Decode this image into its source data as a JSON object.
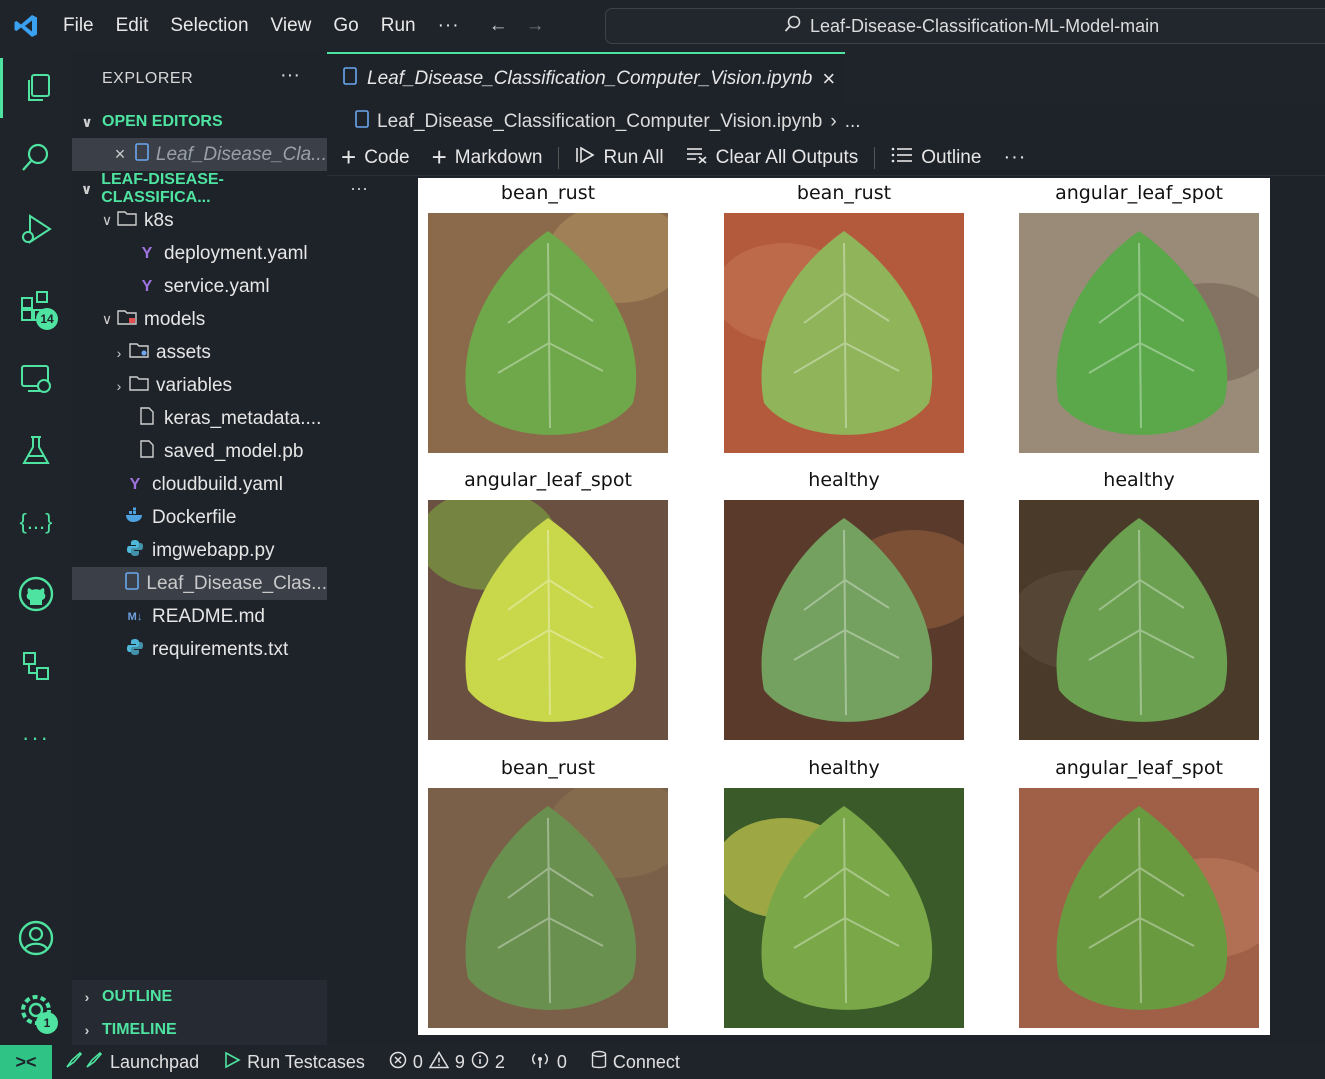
{
  "titlebar": {
    "menu": [
      "File",
      "Edit",
      "Selection",
      "View",
      "Go",
      "Run"
    ],
    "more": "···",
    "search": "Leaf-Disease-Classification-ML-Model-main"
  },
  "activity": {
    "extensions_badge": "14",
    "settings_badge": "1"
  },
  "sidebar": {
    "title": "EXPLORER",
    "dots": "···",
    "open_editors": "OPEN EDITORS",
    "open_editor_file": "Leaf_Disease_Cla...",
    "project": "LEAF-DISEASE-CLASSIFICA...",
    "items": [
      {
        "label": "k8s"
      },
      {
        "label": "deployment.yaml"
      },
      {
        "label": "service.yaml"
      },
      {
        "label": "models"
      },
      {
        "label": "assets"
      },
      {
        "label": "variables"
      },
      {
        "label": "keras_metadata...."
      },
      {
        "label": "saved_model.pb"
      },
      {
        "label": "cloudbuild.yaml"
      },
      {
        "label": "Dockerfile"
      },
      {
        "label": "imgwebapp.py"
      },
      {
        "label": "Leaf_Disease_Clas..."
      },
      {
        "label": "README.md"
      },
      {
        "label": "requirements.txt"
      }
    ],
    "outline": "OUTLINE",
    "timeline": "TIMELINE"
  },
  "editor": {
    "tab_label": "Leaf_Disease_Classification_Computer_Vision.ipynb",
    "breadcrumb_file": "Leaf_Disease_Classification_Computer_Vision.ipynb",
    "breadcrumb_more": "...",
    "toolbar": {
      "code": "Code",
      "markdown": "Markdown",
      "run_all": "Run All",
      "clear": "Clear All Outputs",
      "outline": "Outline",
      "more": "···"
    },
    "cell_dots": "···"
  },
  "output": {
    "images": [
      {
        "label": "bean_rust",
        "palette": [
          "#8a6a4a",
          "#6fa84a",
          "#a88a5c"
        ]
      },
      {
        "label": "bean_rust",
        "palette": [
          "#b45a3c",
          "#8fb45a",
          "#c07050"
        ]
      },
      {
        "label": "angular_leaf_spot",
        "palette": [
          "#9a8a78",
          "#5aa84a",
          "#7a6a58"
        ]
      },
      {
        "label": "angular_leaf_spot",
        "palette": [
          "#6a5040",
          "#c8d84a",
          "#7a9a40"
        ]
      },
      {
        "label": "healthy",
        "palette": [
          "#5a3a2a",
          "#74a060",
          "#8a5a3a"
        ]
      },
      {
        "label": "healthy",
        "palette": [
          "#4a3a2a",
          "#6aa050",
          "#5a4a3a"
        ]
      },
      {
        "label": "bean_rust",
        "palette": [
          "#7a6048",
          "#6a9050",
          "#8a7050"
        ]
      },
      {
        "label": "healthy",
        "palette": [
          "#3a5a2a",
          "#7aa848",
          "#c8c850"
        ]
      },
      {
        "label": "angular_leaf_spot",
        "palette": [
          "#a06048",
          "#6a9a40",
          "#b87858"
        ]
      }
    ]
  },
  "statusbar": {
    "remote": "><",
    "launchpad": "Launchpad",
    "run_testcases": "Run Testcases",
    "errors": "0",
    "warnings": "9",
    "infos": "2",
    "ports": "0",
    "connect": "Connect"
  }
}
